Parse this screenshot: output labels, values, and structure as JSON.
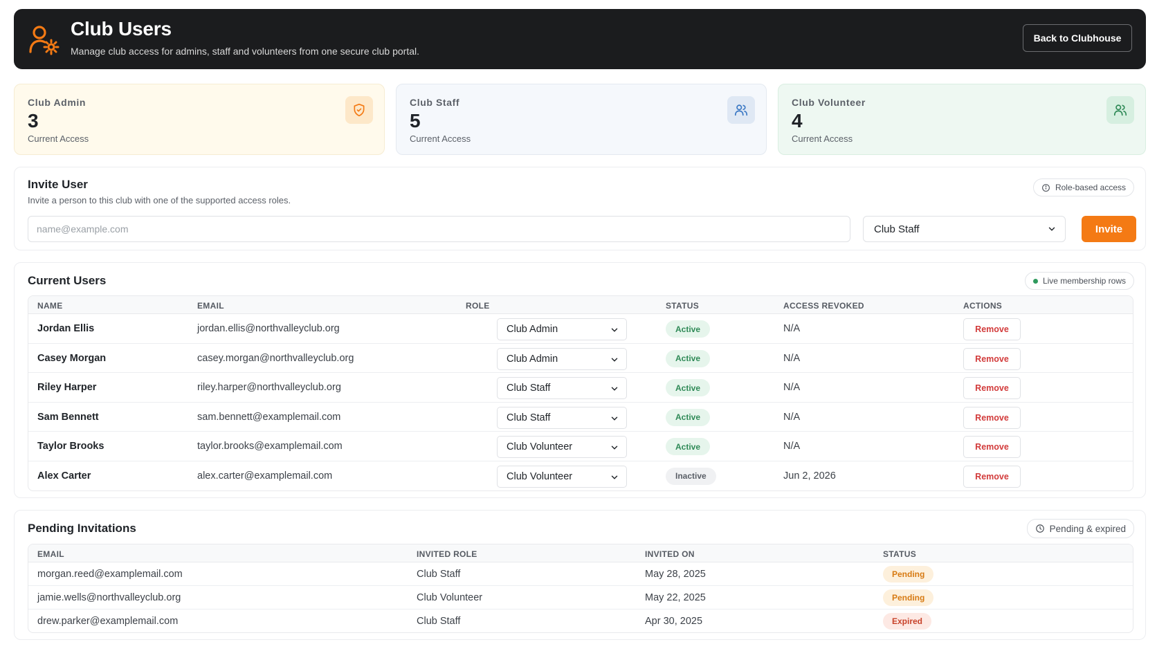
{
  "header": {
    "title": "Club Users",
    "subtitle": "Manage club access for admins, staff and volunteers from one secure club portal.",
    "back_button": "Back to Clubhouse",
    "logo_icon": "user-gear-icon"
  },
  "cards": [
    {
      "label": "Club Admin",
      "count": "3",
      "caption": "Current Access",
      "icon": "shield-check-icon",
      "accent": "#f47a14"
    },
    {
      "label": "Club Staff",
      "count": "5",
      "caption": "Current Access",
      "icon": "users-icon",
      "accent": "#3b78c4"
    },
    {
      "label": "Club Volunteer",
      "count": "4",
      "caption": "Current Access",
      "icon": "users-icon",
      "accent": "#2f8a57"
    }
  ],
  "invite": {
    "title": "Invite User",
    "description": "Invite a person to this club with one of the supported access roles.",
    "badge": "Role-based access",
    "email_value": "",
    "email_placeholder": "name@example.com",
    "role_selected": "Club Staff",
    "button": "Invite"
  },
  "users": {
    "title": "Current Users",
    "badge": "Live membership rows",
    "columns": [
      "NAME",
      "EMAIL",
      "ROLE",
      "STATUS",
      "ACCESS REVOKED",
      "ACTIONS"
    ],
    "rows": [
      {
        "name": "Jordan Ellis",
        "email": "jordan.ellis@northvalleyclub.org",
        "role": "Club Admin",
        "status": "Active",
        "revoked": "N/A",
        "action": "Remove"
      },
      {
        "name": "Casey Morgan",
        "email": "casey.morgan@northvalleyclub.org",
        "role": "Club Admin",
        "status": "Active",
        "revoked": "N/A",
        "action": "Remove"
      },
      {
        "name": "Riley Harper",
        "email": "riley.harper@northvalleyclub.org",
        "role": "Club Staff",
        "status": "Active",
        "revoked": "N/A",
        "action": "Remove"
      },
      {
        "name": "Sam Bennett",
        "email": "sam.bennett@examplemail.com",
        "role": "Club Staff",
        "status": "Active",
        "revoked": "N/A",
        "action": "Remove"
      },
      {
        "name": "Taylor Brooks",
        "email": "taylor.brooks@examplemail.com",
        "role": "Club Volunteer",
        "status": "Active",
        "revoked": "N/A",
        "action": "Remove"
      },
      {
        "name": "Alex Carter",
        "email": "alex.carter@examplemail.com",
        "role": "Club Volunteer",
        "status": "Inactive",
        "revoked": "Jun 2, 2026",
        "action": "Remove"
      }
    ]
  },
  "pending": {
    "title": "Pending Invitations",
    "badge": "Pending & expired",
    "columns": [
      "EMAIL",
      "INVITED ROLE",
      "INVITED ON",
      "STATUS"
    ],
    "rows": [
      {
        "email": "morgan.reed@examplemail.com",
        "role": "Club Staff",
        "invited_on": "May 28, 2025",
        "status": "Pending"
      },
      {
        "email": "jamie.wells@northvalleyclub.org",
        "role": "Club Volunteer",
        "invited_on": "May 22, 2025",
        "status": "Pending"
      },
      {
        "email": "drew.parker@examplemail.com",
        "role": "Club Staff",
        "invited_on": "Apr 30, 2025",
        "status": "Expired"
      }
    ]
  }
}
